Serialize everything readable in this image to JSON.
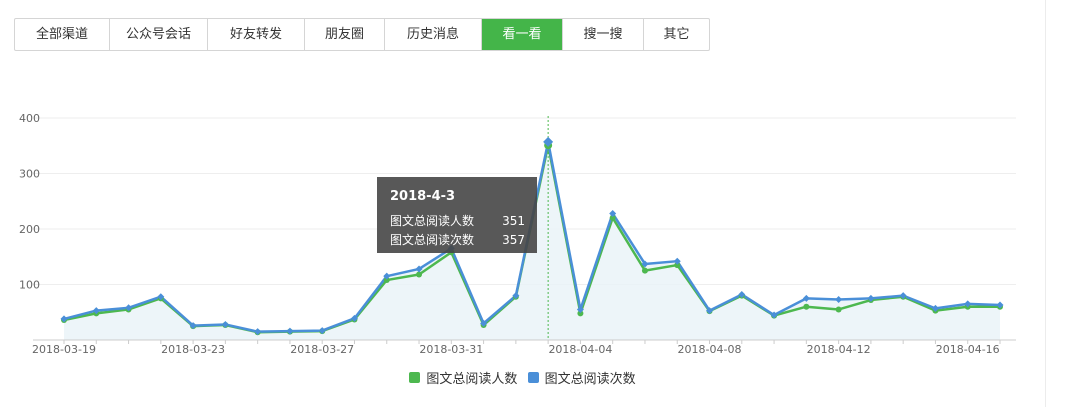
{
  "tabs": [
    {
      "label": "全部渠道",
      "active": false
    },
    {
      "label": "公众号会话",
      "active": false
    },
    {
      "label": "好友转发",
      "active": false
    },
    {
      "label": "朋友圈",
      "active": false
    },
    {
      "label": "历史消息",
      "active": false
    },
    {
      "label": "看一看",
      "active": true
    },
    {
      "label": "搜一搜",
      "active": false
    },
    {
      "label": "其它",
      "active": false
    }
  ],
  "colors": {
    "accent": "#44b549",
    "series_people": "#4db84f",
    "series_reads": "#4a8fd8",
    "area_fill": "#e8f3f8"
  },
  "tooltip": {
    "date": "2018-4-3",
    "rows": [
      {
        "label": "图文总阅读人数",
        "value": "351"
      },
      {
        "label": "图文总阅读次数",
        "value": "357"
      }
    ]
  },
  "chart_data": {
    "type": "line",
    "x": [
      "2018-03-19",
      "2018-03-20",
      "2018-03-21",
      "2018-03-22",
      "2018-03-23",
      "2018-03-24",
      "2018-03-25",
      "2018-03-26",
      "2018-03-27",
      "2018-03-28",
      "2018-03-29",
      "2018-03-30",
      "2018-03-31",
      "2018-04-01",
      "2018-04-02",
      "2018-04-03",
      "2018-04-04",
      "2018-04-05",
      "2018-04-06",
      "2018-04-07",
      "2018-04-08",
      "2018-04-09",
      "2018-04-10",
      "2018-04-11",
      "2018-04-12",
      "2018-04-13",
      "2018-04-14",
      "2018-04-15",
      "2018-04-16",
      "2018-04-17"
    ],
    "x_tick_labels": [
      "2018-03-19",
      "2018-03-23",
      "2018-03-27",
      "2018-03-31",
      "2018-04-04",
      "2018-04-08",
      "2018-04-12",
      "2018-04-16"
    ],
    "series": [
      {
        "name": "图文总阅读人数",
        "values": [
          36,
          48,
          55,
          75,
          25,
          27,
          14,
          15,
          16,
          37,
          108,
          118,
          158,
          27,
          78,
          351,
          48,
          220,
          125,
          135,
          52,
          80,
          44,
          60,
          55,
          72,
          78,
          53,
          60,
          60
        ]
      },
      {
        "name": "图文总阅读次数",
        "values": [
          38,
          53,
          58,
          78,
          26,
          28,
          15,
          16,
          17,
          39,
          115,
          128,
          165,
          30,
          80,
          357,
          55,
          228,
          137,
          142,
          53,
          82,
          45,
          75,
          73,
          75,
          80,
          57,
          65,
          63
        ]
      }
    ],
    "ylim": [
      0,
      400
    ],
    "yticks": [
      100,
      200,
      300,
      400
    ],
    "grid": true,
    "legend": "bottom-center",
    "highlight_x": "2018-04-03"
  }
}
